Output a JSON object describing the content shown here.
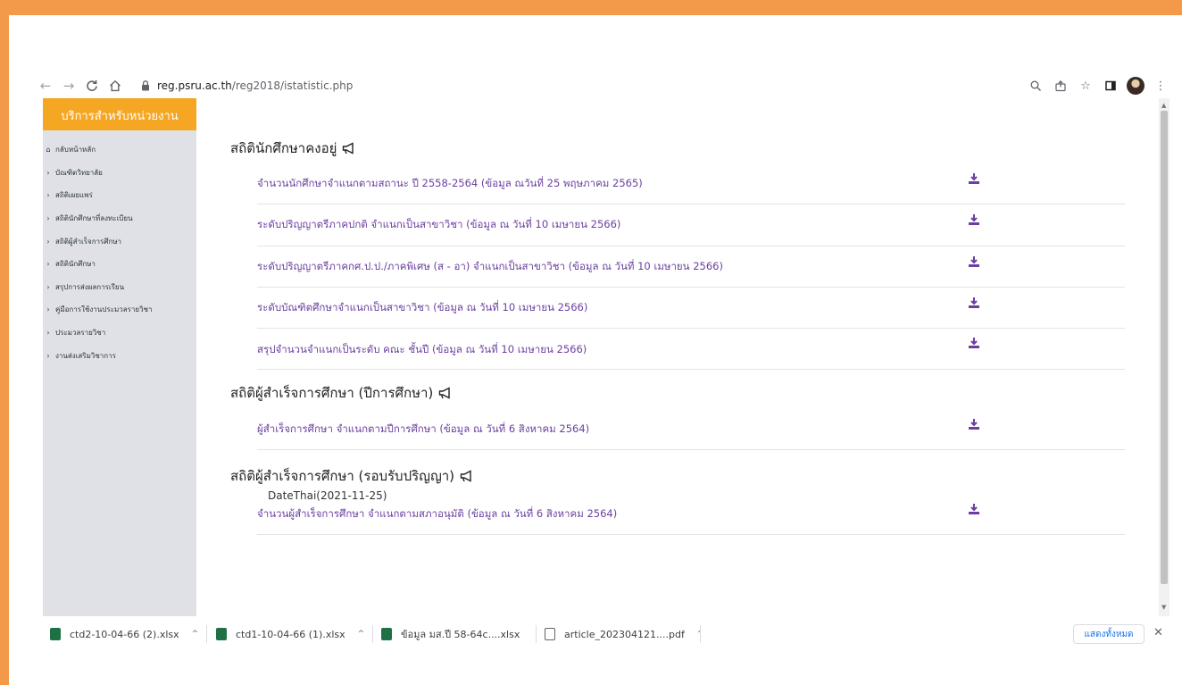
{
  "browser": {
    "url_host": "reg.psru.ac.th",
    "url_path": "/reg2018/istatistic.php"
  },
  "sidebar": {
    "header": "บริการสำหรับหน่วยงาน",
    "items": [
      {
        "label": "กลับหน้าหลัก",
        "icon": "home-icon"
      },
      {
        "label": "บัณฑิตวิทยาลัย",
        "icon": "chevron-right-icon"
      },
      {
        "label": "สถิติเผยแพร่",
        "icon": "chevron-right-icon"
      },
      {
        "label": "สถิตินักศึกษาที่ลงทะเบียน",
        "icon": "chevron-right-icon"
      },
      {
        "label": "สถิติผู้สำเร็จการศึกษา",
        "icon": "chevron-right-icon"
      },
      {
        "label": "สถิตินักศึกษา",
        "icon": "chevron-right-icon"
      },
      {
        "label": "สรุปการส่งผลการเรียน",
        "icon": "chevron-right-icon"
      },
      {
        "label": "คู่มือการใช้งานประมวลรายวิชา",
        "icon": "chevron-right-icon"
      },
      {
        "label": "ประมวลรายวิชา",
        "icon": "chevron-right-icon"
      },
      {
        "label": "งานส่งเสริมวิชาการ",
        "icon": "chevron-right-icon"
      }
    ]
  },
  "sections": [
    {
      "title": "สถิตินักศึกษาคงอยู่",
      "rows": [
        {
          "label": "จำนวนนักศึกษาจำแนกตามสถานะ ปี 2558-2564 (ข้อมูล ณวันที่ 25 พฤษภาคม 2565)"
        },
        {
          "label": "ระดับปริญญาตรีภาคปกติ จำแนกเป็นสาขาวิชา (ข้อมูล ณ วันที่ 10 เมษายน 2566)"
        },
        {
          "label": "ระดับปริญญาตรีภาคกศ.ป.ป./ภาคพิเศษ (ส - อา) จำแนกเป็นสาขาวิชา (ข้อมูล ณ วันที่ 10 เมษายน 2566)"
        },
        {
          "label": "ระดับบัณฑิตศึกษาจำแนกเป็นสาขาวิชา (ข้อมูล ณ วันที่ 10 เมษายน 2566)"
        },
        {
          "label": "สรุปจำนวนจำแนกเป็นระดับ คณะ ชั้นปี (ข้อมูล ณ วันที่ 10 เมษายน 2566)"
        }
      ]
    },
    {
      "title": "สถิติผู้สำเร็จการศึกษา (ปีการศึกษา)",
      "rows": [
        {
          "label": "ผู้สำเร็จการศึกษา จำแนกตามปีการศึกษา (ข้อมูล ณ วันที่ 6 สิงหาคม 2564)"
        }
      ]
    },
    {
      "title": "สถิติผู้สำเร็จการศึกษา (รอบรับปริญญา)",
      "note": "DateThai(2021-11-25)",
      "rows": [
        {
          "label": "จำนวนผู้สำเร็จการศึกษา จำแนกตามสภาอนุมัติ (ข้อมูล ณ วันที่ 6 สิงหาคม 2564)"
        }
      ]
    }
  ],
  "downloads": {
    "items": [
      {
        "name": "ctd2-10-04-66 (2).xlsx",
        "type": "xls"
      },
      {
        "name": "ctd1-10-04-66 (1).xlsx",
        "type": "xls"
      },
      {
        "name": "ข้อมูล มส.ปี 58-64c....xlsx",
        "type": "xls"
      },
      {
        "name": "article_202304121....pdf",
        "type": "pdf"
      }
    ],
    "show_all": "แสดงทั้งหมด"
  },
  "colors": {
    "frame": "#f2994a",
    "sidebar_header": "#f5a623",
    "sidebar_bg": "#dfe1e6",
    "link": "#6b3fa0"
  }
}
